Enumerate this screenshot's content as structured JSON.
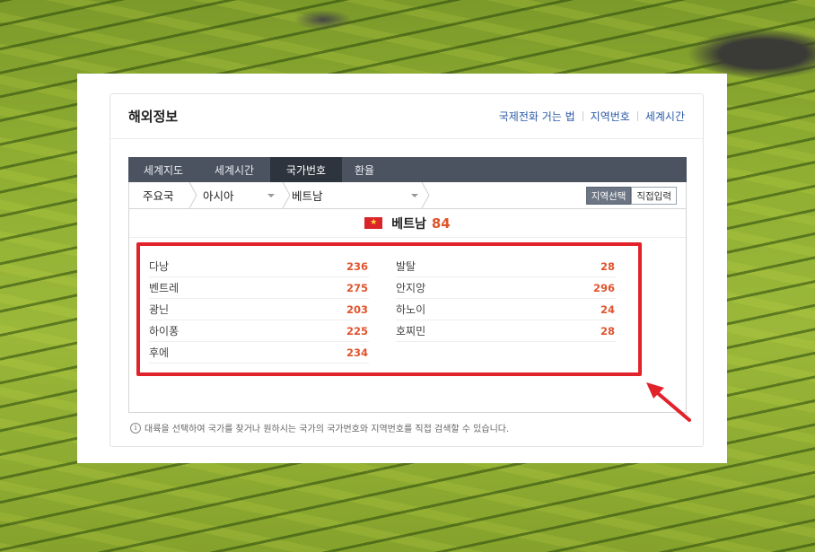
{
  "header": {
    "title": "해외정보",
    "links": [
      "국제전화 거는 법",
      "지역번호",
      "세계시간"
    ]
  },
  "tabs": [
    "세계지도",
    "세계시간",
    "국가번호",
    "환율"
  ],
  "active_tab": "국가번호",
  "breadcrumb": {
    "level1": "주요국",
    "level2": "아시아",
    "level3": "베트남"
  },
  "mode_buttons": {
    "select": "지역선택",
    "direct": "직접입력"
  },
  "country": {
    "name": "베트남",
    "code": "84",
    "flag_icon": "vietnam-flag-icon"
  },
  "regions_left": [
    {
      "name": "다낭",
      "code": "236"
    },
    {
      "name": "벤트레",
      "code": "275"
    },
    {
      "name": "광닌",
      "code": "203"
    },
    {
      "name": "하이퐁",
      "code": "225"
    },
    {
      "name": "후에",
      "code": "234"
    }
  ],
  "regions_right": [
    {
      "name": "발탈",
      "code": "28"
    },
    {
      "name": "안지앙",
      "code": "296"
    },
    {
      "name": "하노이",
      "code": "24"
    },
    {
      "name": "호찌민",
      "code": "28"
    }
  ],
  "note": "대륙을 선택하여 국가를 찾거나 원하시는 국가의 국가번호와 지역번호를 직접 검색할 수 있습니다.",
  "colors": {
    "accent_code": "#e0542c",
    "tab_bar": "#4b5360",
    "highlight": "#e2222a",
    "link": "#2a5aa8"
  }
}
